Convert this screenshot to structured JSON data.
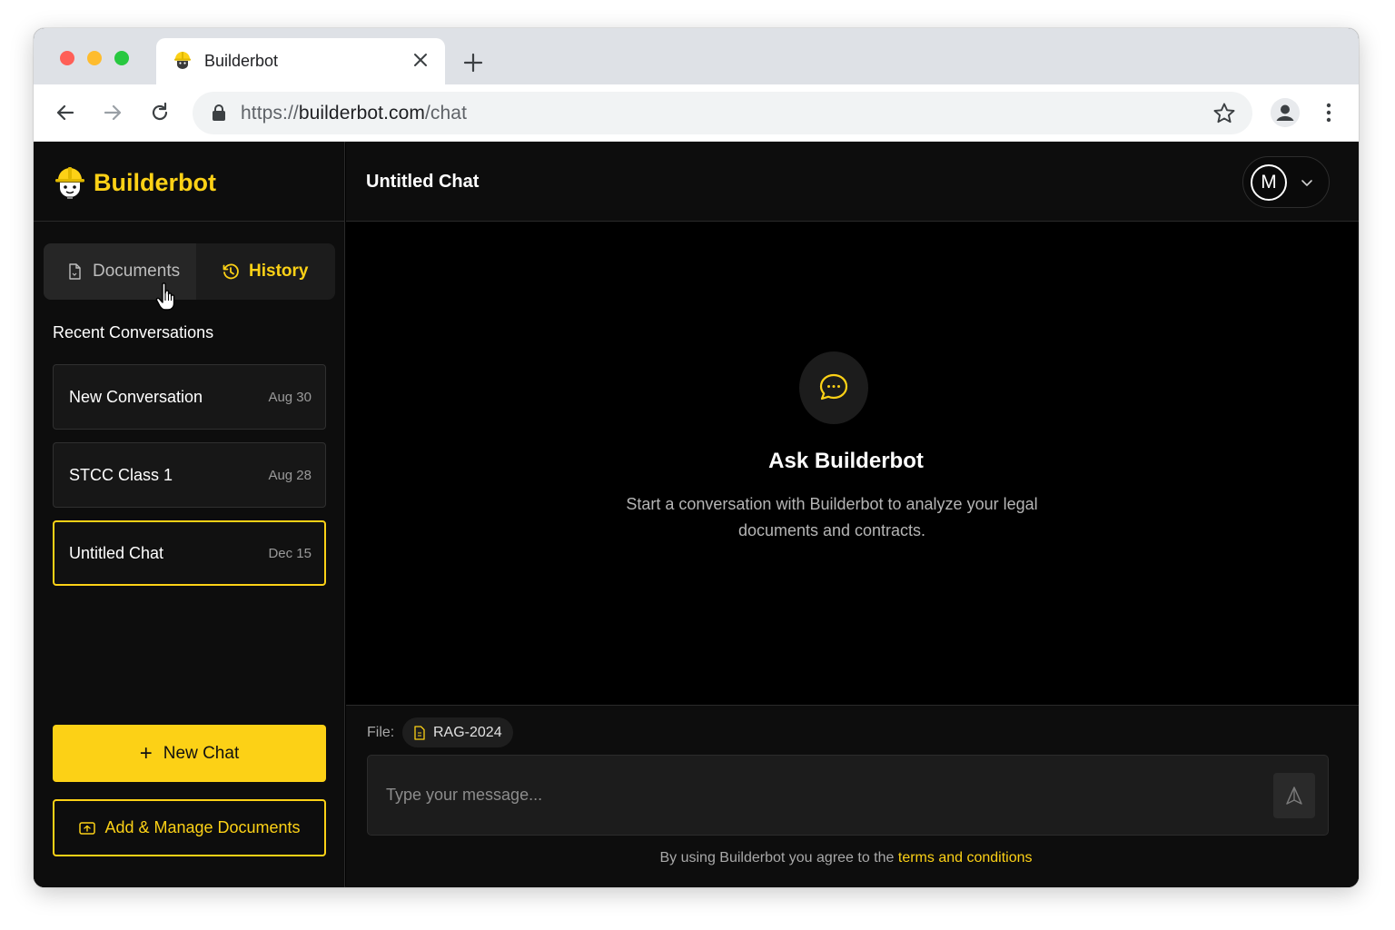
{
  "browser": {
    "tab_title": "Builderbot",
    "url_scheme": "https://",
    "url_host": "builderbot.com",
    "url_path": "/chat"
  },
  "brand": {
    "name": "Builderbot"
  },
  "sidebar": {
    "tabs": [
      {
        "label": "Documents",
        "icon": "document-icon",
        "active": false
      },
      {
        "label": "History",
        "icon": "clock-icon",
        "active": true
      }
    ],
    "recent_title": "Recent Conversations",
    "conversations": [
      {
        "title": "New Conversation",
        "date": "Aug 30",
        "active": false
      },
      {
        "title": "STCC Class 1",
        "date": "Aug 28",
        "active": false
      },
      {
        "title": "Untitled Chat",
        "date": "Dec 15",
        "active": true
      }
    ],
    "new_chat_label": "New Chat",
    "manage_docs_label": "Add & Manage Documents"
  },
  "header": {
    "chat_title": "Untitled Chat",
    "avatar_initial": "M"
  },
  "empty_state": {
    "icon": "chat-bubble-icon",
    "title": "Ask Builderbot",
    "description": "Start a conversation with Builderbot to analyze your legal documents and contracts."
  },
  "composer": {
    "file_label": "File:",
    "file_name": "RAG-2024",
    "placeholder": "Type your message...",
    "terms_prefix": "By using Builderbot you agree to the",
    "terms_link": "terms and conditions"
  },
  "colors": {
    "accent": "#fcd116",
    "background": "#000000",
    "sidebar": "#0d0d0d"
  }
}
